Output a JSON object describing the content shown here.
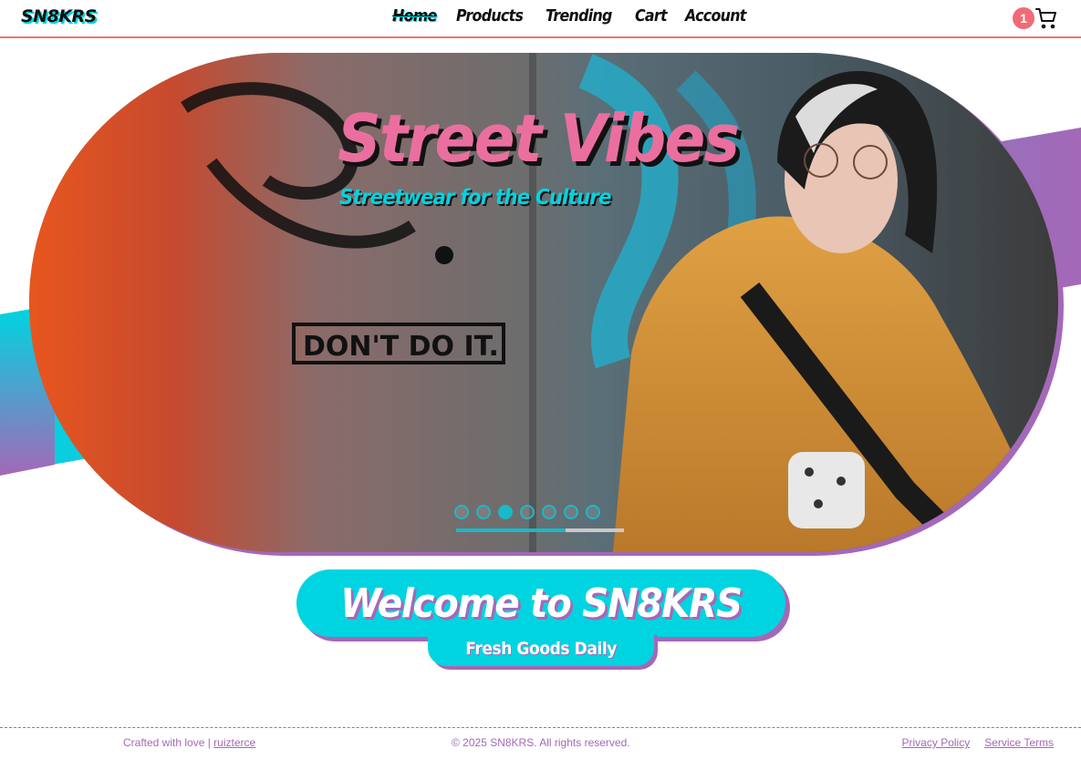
{
  "header": {
    "logo": "SN8KRS",
    "nav": [
      {
        "label": "Home",
        "active": true
      },
      {
        "label": "Products"
      },
      {
        "label": "Trending"
      },
      {
        "label": "Cart"
      },
      {
        "label": "Account"
      }
    ],
    "cart_count": "1",
    "cart_icon": "shopping-cart-icon"
  },
  "hero": {
    "title": "Street Vibes",
    "subtitle": "Streetwear for the Culture",
    "slides_count": 7,
    "active_slide": 3,
    "progress": 0.65
  },
  "welcome": {
    "title": "Welcome to SN8KRS",
    "subtitle": "Fresh Goods Daily"
  },
  "footer": {
    "crafted_text": "Crafted with love | ",
    "author_link": "ruizterce",
    "copyright": "© 2025 SN8KRS. All rights reserved.",
    "privacy_label": "Privacy Policy",
    "terms_label": "Service Terms"
  },
  "colors": {
    "accent_cyan": "#00d4e0",
    "accent_purple": "#a468b8",
    "accent_pink": "#ea6f9f",
    "header_border": "#e8757f",
    "badge": "#ef6b76"
  }
}
